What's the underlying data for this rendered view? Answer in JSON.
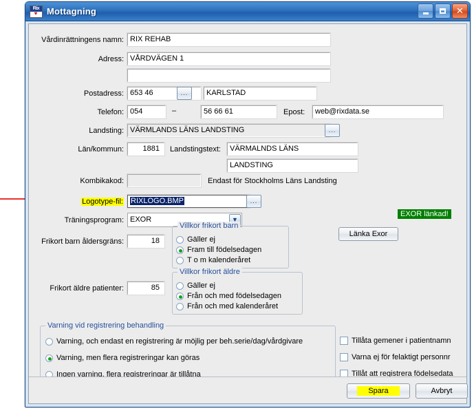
{
  "window": {
    "title": "Mottagning",
    "icon_name": "rix-logo-icon",
    "icon_text": "Rix",
    "minimize_label": "–",
    "maximize_label": "□",
    "close_label": "✕"
  },
  "fields": {
    "name_label": "Vårdinrättningens namn:",
    "name_value": "RIX REHAB",
    "address_label": "Adress:",
    "address_value": "VÅRDVÄGEN 1",
    "address2_value": "",
    "postal_label": "Postadress:",
    "postal_code": "653 46",
    "postal_city": "KARLSTAD",
    "postal_browse": "...",
    "phone_label": "Telefon:",
    "phone_area": "054",
    "phone_separator": "–",
    "phone_number": "56 66 61",
    "email_label": "Epost:",
    "email_value": "web@rixdata.se",
    "county_council_label": "Landsting:",
    "county_council_value": "VÄRMLANDS LÄNS LANDSTING",
    "county_council_browse": "...",
    "municipality_label": "Län/kommun:",
    "municipality_value": "1881",
    "council_text_label": "Landstingstext:",
    "council_text_line1": "VÄRMALNDS LÄNS",
    "council_text_line2": "LANDSTING",
    "kombika_label": "Kombikakod:",
    "kombika_value": "",
    "kombika_note": "Endast för Stockholms Läns Landsting",
    "logotype_label": "Logotype-fil:",
    "logotype_value": "RIXLOGO.BMP",
    "logotype_browse": "...",
    "training_label": "Träningsprogram:",
    "training_value": "EXOR",
    "child_age_label": "Frikort barn åldersgräns:",
    "child_age_value": "18",
    "senior_age_label": "Frikort äldre patienter:",
    "senior_age_value": "85"
  },
  "exor": {
    "badge": "EXOR länkad!",
    "badge_color": "#008000",
    "link_button": "Länka Exor"
  },
  "group_child": {
    "title": "Villkor frikort barn",
    "options": [
      {
        "label": "Gäller ej",
        "selected": false
      },
      {
        "label": "Fram till födelsedagen",
        "selected": true
      },
      {
        "label": "T o m kalenderåret",
        "selected": false
      }
    ]
  },
  "group_senior": {
    "title": "Villkor frikort äldre",
    "options": [
      {
        "label": "Gäller ej",
        "selected": false
      },
      {
        "label": "Från och med födelsedagen",
        "selected": true
      },
      {
        "label": "Från och med kalenderåret",
        "selected": false
      }
    ]
  },
  "group_warning": {
    "title": "Varning vid registrering behandling",
    "options": [
      {
        "label": "Varning, och endast en registrering är möjlig per beh.serie/dag/vårdgivare",
        "selected": false
      },
      {
        "label": "Varning, men flera registreringar kan göras",
        "selected": true
      },
      {
        "label": "Ingen varning, flera registreringar är tillåtna",
        "selected": false
      }
    ]
  },
  "checkboxes": [
    {
      "label": "Tillåta gemener i patientnamn",
      "checked": false
    },
    {
      "label": "Varna ej för felaktigt personnr",
      "checked": false
    },
    {
      "label": "Tillåt att registrera födelsedata",
      "checked": false
    }
  ],
  "footer": {
    "save_label": "Spara",
    "cancel_label": "Avbryt"
  },
  "annotation": {
    "arrow_color": "#e8312a"
  }
}
